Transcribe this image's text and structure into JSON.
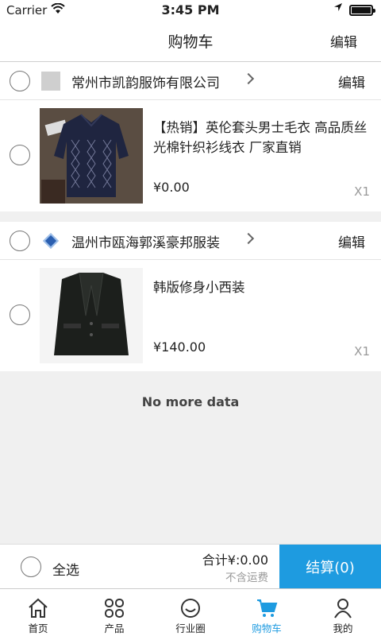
{
  "status_bar": {
    "carrier": "Carrier",
    "time": "3:45 PM"
  },
  "nav": {
    "title": "购物车",
    "edit_label": "编辑"
  },
  "shops": [
    {
      "name": "常州市凯韵服饰有限公司",
      "edit_label": "编辑",
      "logo": "gray-placeholder",
      "items": [
        {
          "name": "【热销】英伦套头男士毛衣 高品质丝光棉针织衫线衣 厂家直销",
          "price": "¥0.00",
          "qty": "X1",
          "image": "navy-argyle-sweater"
        }
      ]
    },
    {
      "name": "温州市瓯海郭溪豪邦服装",
      "edit_label": "编辑",
      "logo": "blue-diamond",
      "items": [
        {
          "name": "韩版修身小西装",
          "price": "¥140.00",
          "qty": "X1",
          "image": "black-blazer"
        }
      ]
    }
  ],
  "no_more": "No more data",
  "footer": {
    "select_all": "全选",
    "total": "合计¥:0.00",
    "shipping": "不含运费",
    "checkout": "结算(0)"
  },
  "tabs": [
    {
      "label": "首页",
      "icon": "home-icon"
    },
    {
      "label": "产品",
      "icon": "grid-icon"
    },
    {
      "label": "行业圈",
      "icon": "smiley-icon"
    },
    {
      "label": "购物车",
      "icon": "cart-icon",
      "active": true
    },
    {
      "label": "我的",
      "icon": "user-icon"
    }
  ],
  "colors": {
    "accent": "#1e9be0",
    "background": "#f0f0f0"
  }
}
